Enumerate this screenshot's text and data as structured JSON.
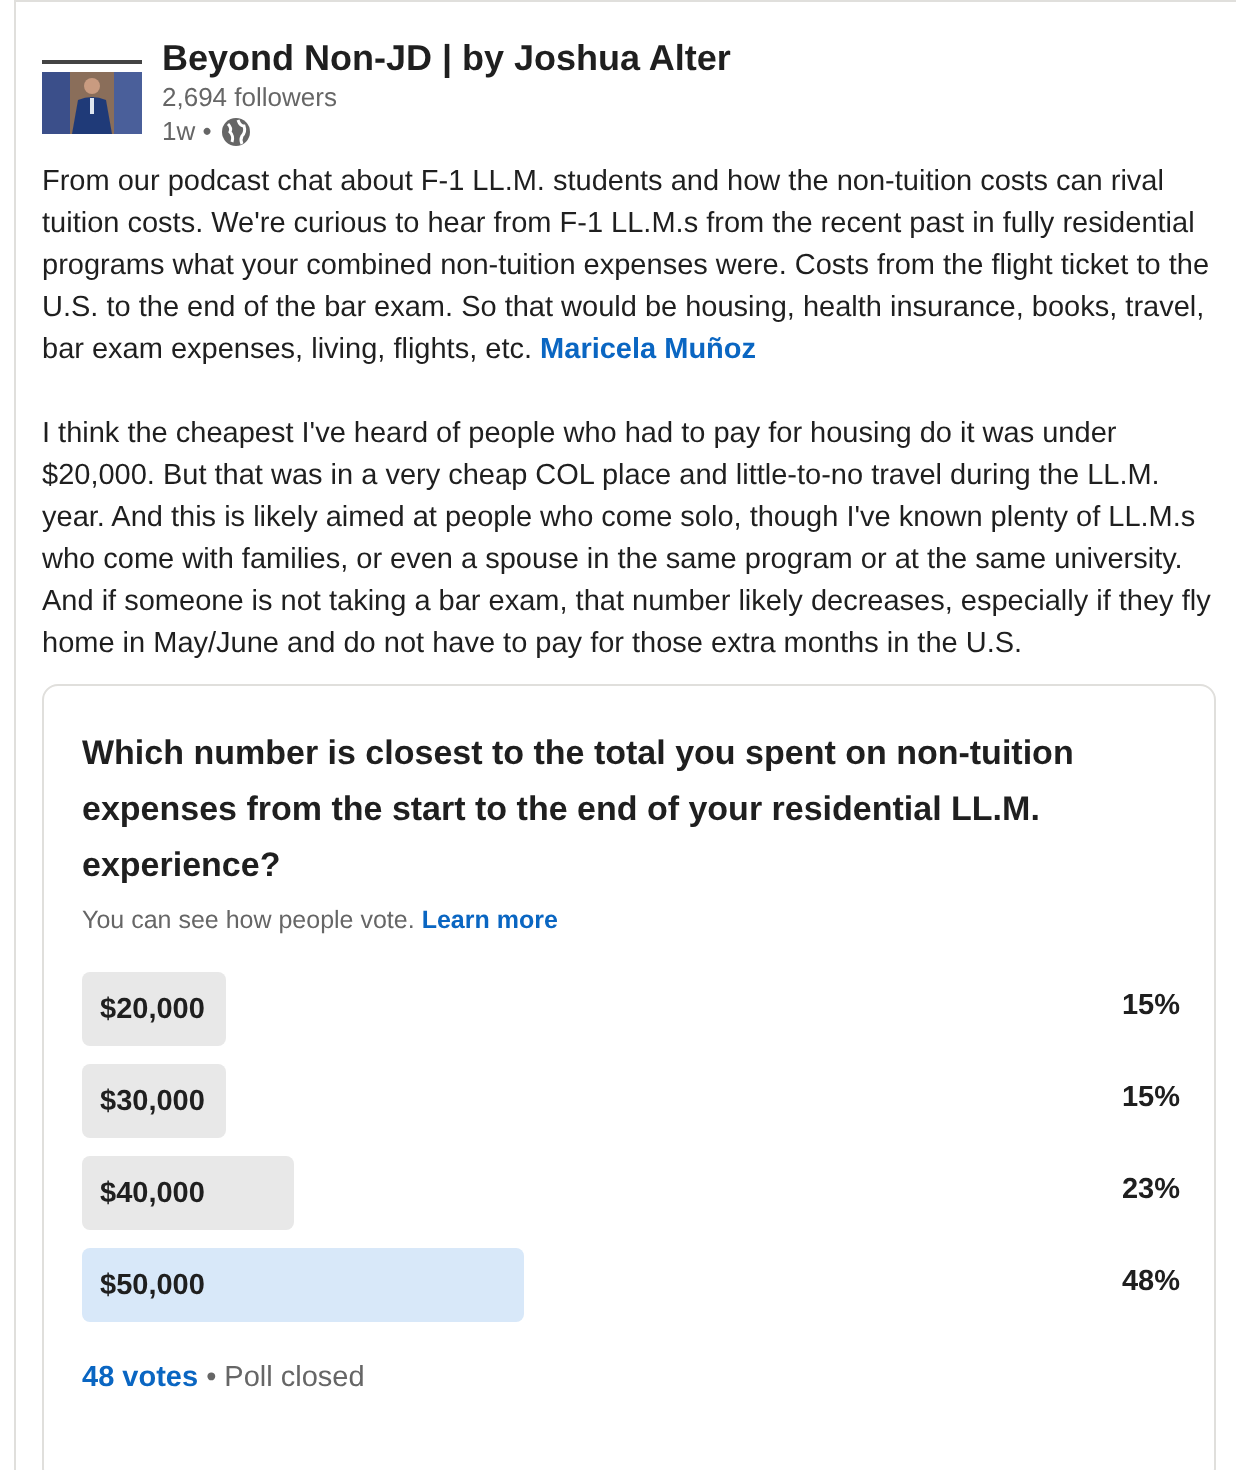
{
  "author": {
    "name": "Beyond Non-JD | by Joshua Alter",
    "followers": "2,694 followers",
    "time": "1w •"
  },
  "post": {
    "text": "From our podcast chat about F-1 LL.M. students and how the non-tuition costs can rival tuition costs. We're curious to hear from F-1 LL.M.s from the recent past in fully residential programs what your combined non-tuition expenses were. Costs from the flight ticket to the U.S. to the end of the bar exam. So that would be housing, health insurance, books, travel, bar exam expenses, living, flights, etc.",
    "mention": "Maricela Muñoz",
    "paragraph_2": "I think the cheapest I've heard of people who had to pay for housing do it was under $20,000. But that was in a very cheap COL place and little-to-no travel during the LL.M. year. And this is likely aimed at people who come solo, though I've known plenty of LL.M.s who come with families, or even a spouse in the same program or at the same university. And if someone is not taking a bar exam, that number likely decreases, especially if they fly home in May/June and do not have to pay for those extra months in the U.S."
  },
  "poll": {
    "question": "Which number is closest to the total you spent on non-tuition expenses from the start to the end of your residential LL.M. experience?",
    "note": "You can see how people vote.",
    "note_link": "Learn more",
    "options": [
      {
        "label": "$20,000",
        "percent": "15%",
        "leading": false
      },
      {
        "label": "$30,000",
        "percent": "15%",
        "leading": false
      },
      {
        "label": "$40,000",
        "percent": "23%",
        "leading": false
      },
      {
        "label": "$50,000",
        "percent": "48%",
        "leading": true
      }
    ],
    "votes": "48 votes",
    "status": "• Poll closed"
  }
}
